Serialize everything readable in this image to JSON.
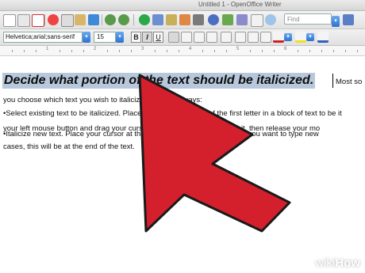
{
  "window": {
    "title": "Untitled 1 - OpenOffice Writer"
  },
  "toolbar": {
    "find_placeholder": "Find"
  },
  "format_bar": {
    "font_name": "Helvetica;arial;sans-serif",
    "font_size": "15",
    "bold_label": "B",
    "italic_label": "I",
    "underline_label": "U"
  },
  "ruler": {
    "numbers": [
      "1",
      "2",
      "3",
      "4",
      "5",
      "6"
    ]
  },
  "document": {
    "heading": "Decide what portion of the text should be italicized.",
    "heading_tail": "Most so",
    "lines": [
      "you choose which text you wish to italicize one of two ways:",
      "•Select existing text to be italicized. Place your cursor in front of the first letter in a block of text to be it",
      "your left mouse button and drag your cursor across the text to highlight it, then release your mo",
      "•Italicize new text. Place your cursor at the point in your document where you want to type new",
      "cases, this will be at the end of the text."
    ]
  },
  "overlay": {
    "arrow_color": "#d4202c"
  },
  "watermark": {
    "brand_a": "wiki",
    "brand_b": "How"
  }
}
